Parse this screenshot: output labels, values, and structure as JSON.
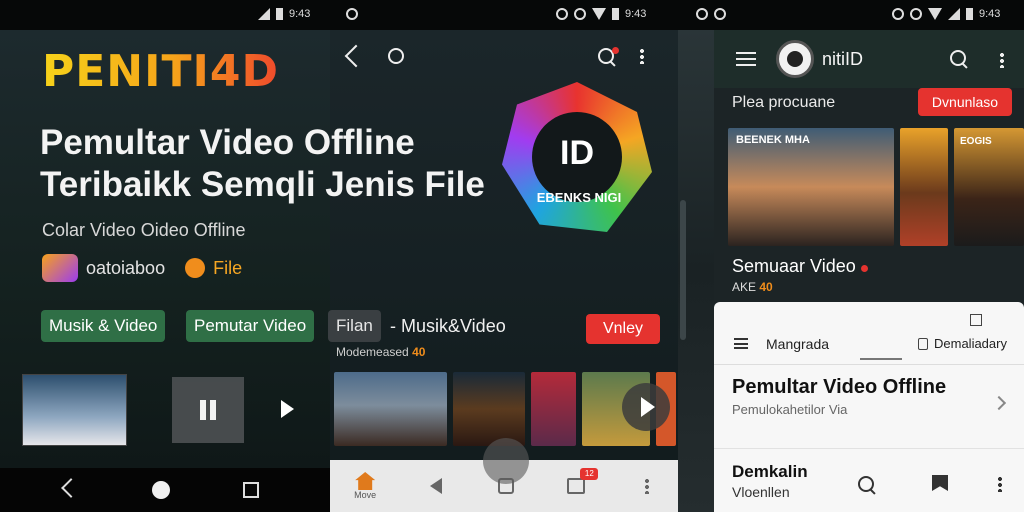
{
  "status_bar": {
    "left_time": "9:43",
    "middle_time": "9:43",
    "right_time": "9:43"
  },
  "hero": {
    "brand": "PENITI4D",
    "headline_line1": "Pemultar Video Offline",
    "headline_line2": "Teribaikk Semqli Jenis File",
    "subline": "Colar Video Oideo Offline",
    "app_name": "oatoiaboo",
    "file_label": "File",
    "badge_text_main": "ID",
    "badge_text_sub": "EBENKS NIGI"
  },
  "chips": {
    "chip1": "Musik & Video",
    "chip2": "Pemutar Video",
    "chip3": "Filan",
    "musik_label": "- Musik&Video",
    "vnley_button": "Vnley",
    "note_text": "Modemeased",
    "note_num": "40"
  },
  "bottom_nav": {
    "home_label": "Move",
    "badge_count": "12"
  },
  "right_panel": {
    "app_title": "nitiID",
    "subtitle": "Plea procuane",
    "download_button": "Dvnunlaso",
    "poster_title": "BEENEK MHA",
    "poster3_title": "EOGIS",
    "section_title": "Semuaar Video",
    "section_small": "AKE",
    "section_small_num": "40",
    "tab1": "Mangrada",
    "tab2": "Demaliadary",
    "row_title": "Pemultar Video Offline",
    "row_sub": "Pemulokahetilor Via",
    "row2_title": "Demkalin",
    "row2_sub": "Vloenllen"
  },
  "colors": {
    "accent_red": "#e5332f",
    "chip_green": "#2f6f46",
    "brand_orange": "#f5a623"
  }
}
